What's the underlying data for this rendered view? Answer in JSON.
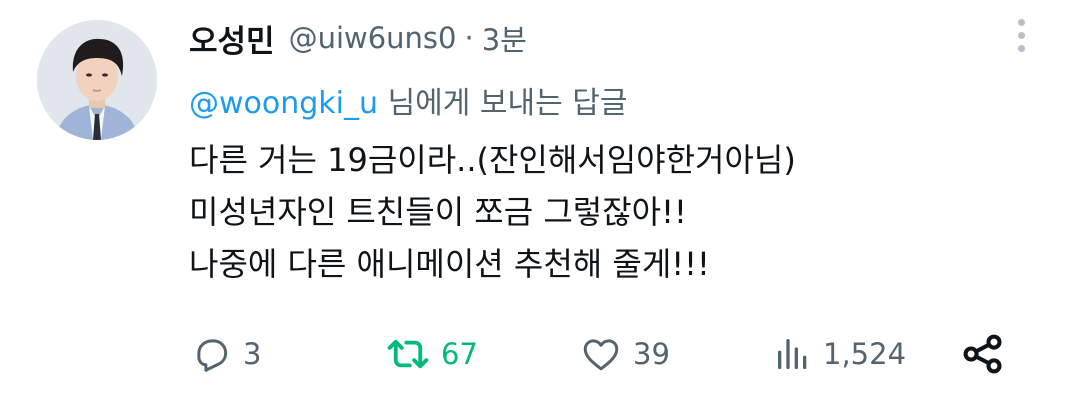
{
  "tweet": {
    "display_name": "오성민",
    "handle": "@uiw6uns0",
    "separator": "·",
    "time": "3분",
    "reply_to_handle": "@woongki_u",
    "reply_to_suffix": " 님에게 보내는 답글",
    "body_lines": [
      "다른 거는 19금이라..(잔인해서임야한거아님)",
      "미성년자인 트친들이 쪼금 그렇잖아!!",
      "나중에 다른 애니메이션 추천해 줄게!!!"
    ]
  },
  "actions": {
    "reply_count": "3",
    "retweet_count": "67",
    "like_count": "39",
    "view_count": "1,524"
  },
  "colors": {
    "text": "#0f1419",
    "secondary": "#536471",
    "link": "#1d9bf0",
    "retweet_active": "#00ba7c"
  },
  "icons": [
    "more-vertical-icon",
    "reply-icon",
    "retweet-icon",
    "like-icon",
    "views-icon",
    "share-icon"
  ]
}
